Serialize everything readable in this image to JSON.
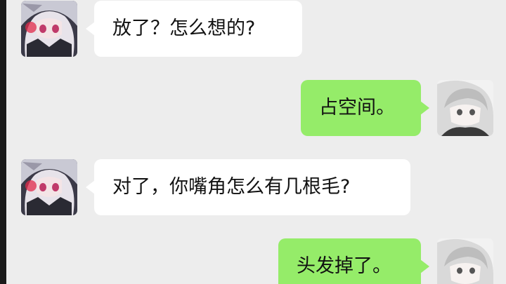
{
  "colors": {
    "background": "#ededed",
    "incoming_bubble": "#ffffff",
    "outgoing_bubble": "#95ec69"
  },
  "messages": [
    {
      "sender": "other",
      "avatar_icon": "anime-girl-avatar-icon",
      "text": "放了？怎么想的?"
    },
    {
      "sender": "self",
      "avatar_icon": "white-hair-girl-avatar-icon",
      "text": "占空间。"
    },
    {
      "sender": "other",
      "avatar_icon": "anime-girl-avatar-icon",
      "text": "对了，你嘴角怎么有几根毛?"
    },
    {
      "sender": "self",
      "avatar_icon": "white-hair-girl-avatar-icon",
      "text": "头发掉了。"
    }
  ]
}
